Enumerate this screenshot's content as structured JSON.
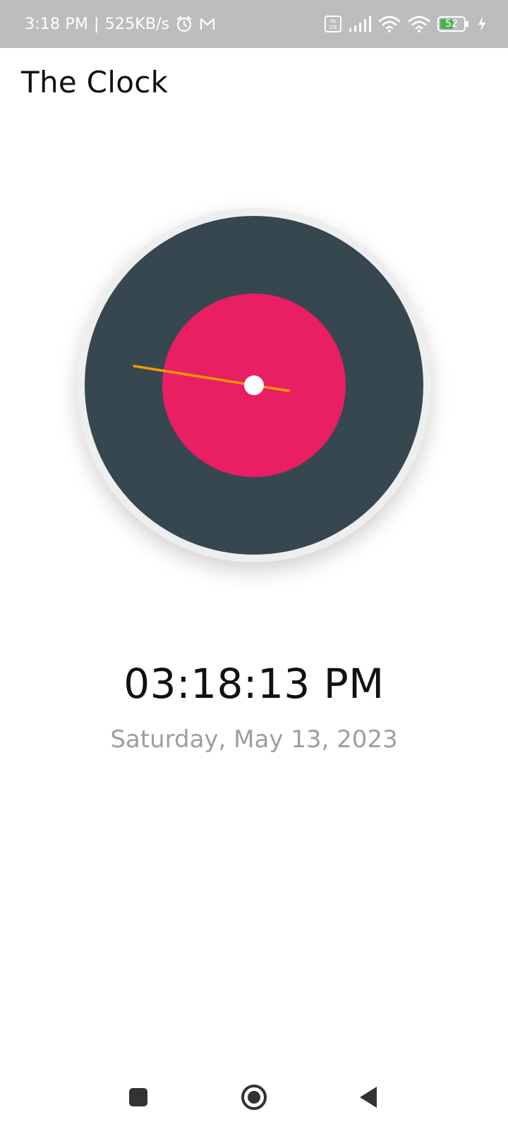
{
  "status_bar": {
    "time": "3:18 PM",
    "separator": "|",
    "network_speed": "525KB/s",
    "battery_level": "52",
    "icons": [
      "alarm-icon",
      "gmail-icon",
      "volte-icon",
      "signal-icon",
      "wifi-icon",
      "wifi-icon",
      "battery-icon",
      "charging-icon"
    ]
  },
  "app": {
    "title": "The Clock"
  },
  "clock": {
    "hands": {
      "hour": 3,
      "minute": 18,
      "second": 13
    },
    "colors": {
      "bezel": "#eeeeee",
      "face": "#37474f",
      "inner": "#e91e63",
      "hand": "#ff9800",
      "center": "#ffffff"
    }
  },
  "display": {
    "time": "03:18:13 PM",
    "date": "Saturday, May 13, 2023"
  },
  "nav": {
    "buttons": [
      "recents-icon",
      "home-icon",
      "back-icon"
    ]
  }
}
